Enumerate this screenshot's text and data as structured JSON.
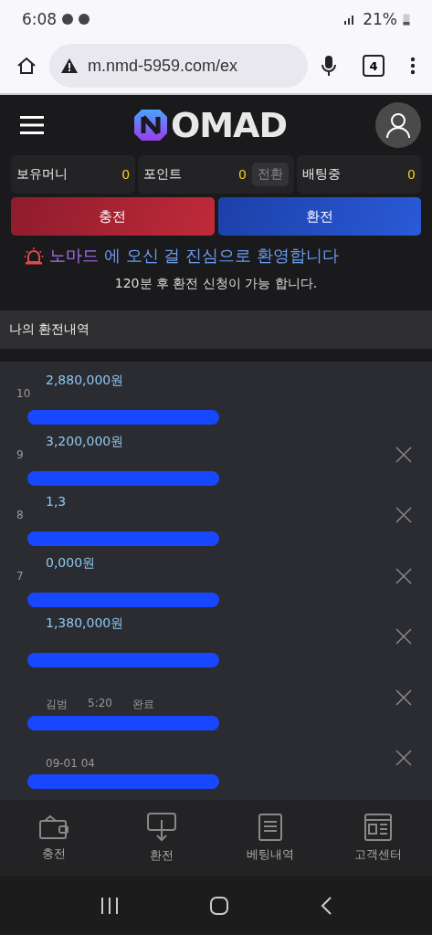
{
  "status_bar": {
    "time": "6:08",
    "battery": "21%"
  },
  "browser": {
    "url": "m.nmd-5959.com/ex",
    "tab_count": "4"
  },
  "header": {
    "logo": "OMAD"
  },
  "balances": [
    {
      "label": "보유머니",
      "value": "0"
    },
    {
      "label": "포인트",
      "value": "0",
      "action": "전환"
    },
    {
      "label": "배팅중",
      "value": "0"
    }
  ],
  "actions": [
    {
      "label": "충전",
      "kind": "deposit"
    },
    {
      "label": "환전",
      "kind": "withdraw"
    }
  ],
  "welcome": {
    "brand": "노마드",
    "message": "에 오신 걸 진심으로 환영합니다"
  },
  "notice": "120분 후 환전 신청이 가능 합니다.",
  "section_title": "나의 환전내역",
  "rows": [
    {
      "number": "10",
      "amount": "2,880,000원",
      "removable": false
    },
    {
      "number": "9",
      "amount": "3,200,000원",
      "removable": true
    },
    {
      "number": "8",
      "amount": "1,3",
      "removable": true
    },
    {
      "number": "7",
      "amount": "0,000원",
      "removable": true
    },
    {
      "amount": "1,380,000원",
      "removable": true
    },
    {
      "details": [
        "김범",
        "5:20",
        "완료"
      ],
      "removable": true
    },
    {
      "details": [
        "09-01 04"
      ],
      "removable": true
    }
  ],
  "bottom_nav": [
    {
      "label": "충전"
    },
    {
      "label": "환전"
    },
    {
      "label": "베팅내역"
    },
    {
      "label": "고객센터"
    }
  ]
}
